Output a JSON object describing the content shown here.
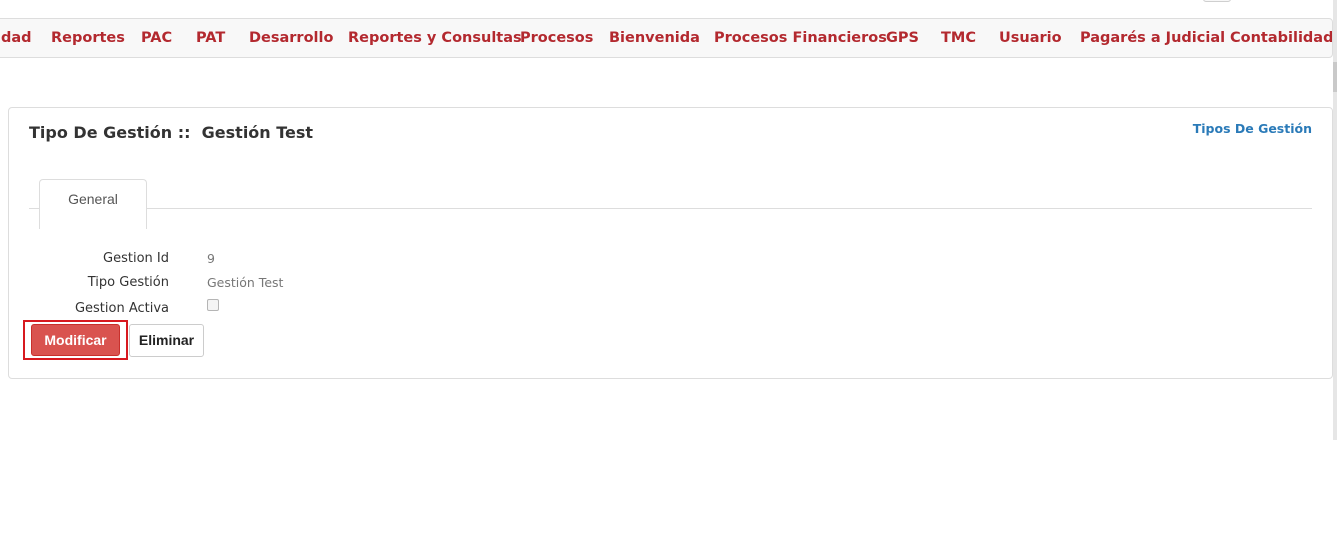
{
  "nav": {
    "items": [
      {
        "label": "dad"
      },
      {
        "label": "Reportes"
      },
      {
        "label": "PAC"
      },
      {
        "label": "PAT"
      },
      {
        "label": "Desarrollo"
      },
      {
        "label": "Reportes y Consultas"
      },
      {
        "label": "Procesos"
      },
      {
        "label": "Bienvenida"
      },
      {
        "label": "Procesos Financieros"
      },
      {
        "label": "GPS"
      },
      {
        "label": "TMC"
      },
      {
        "label": "Usuario"
      },
      {
        "label": "Pagarés a Judicial"
      },
      {
        "label": "Contabilidad"
      }
    ]
  },
  "colors": {
    "nav_text": "#b3292f",
    "link": "#2a7ab8",
    "danger_button": "#d9534f",
    "highlight_border": "#d7191f"
  },
  "panel": {
    "title_prefix": "Tipo De Gestión ::",
    "title_name": "Gestión Test",
    "breadcrumb_link": "Tipos De Gestión"
  },
  "tabs": [
    {
      "label": "General",
      "active": true
    }
  ],
  "fields": {
    "gestion_id": {
      "label": "Gestion Id",
      "value": "9"
    },
    "tipo_gestion": {
      "label": "Tipo Gestión",
      "value": "Gestión Test"
    },
    "gestion_activa": {
      "label": "Gestion Activa",
      "checked": false
    }
  },
  "buttons": {
    "modificar": "Modificar",
    "eliminar": "Eliminar"
  }
}
